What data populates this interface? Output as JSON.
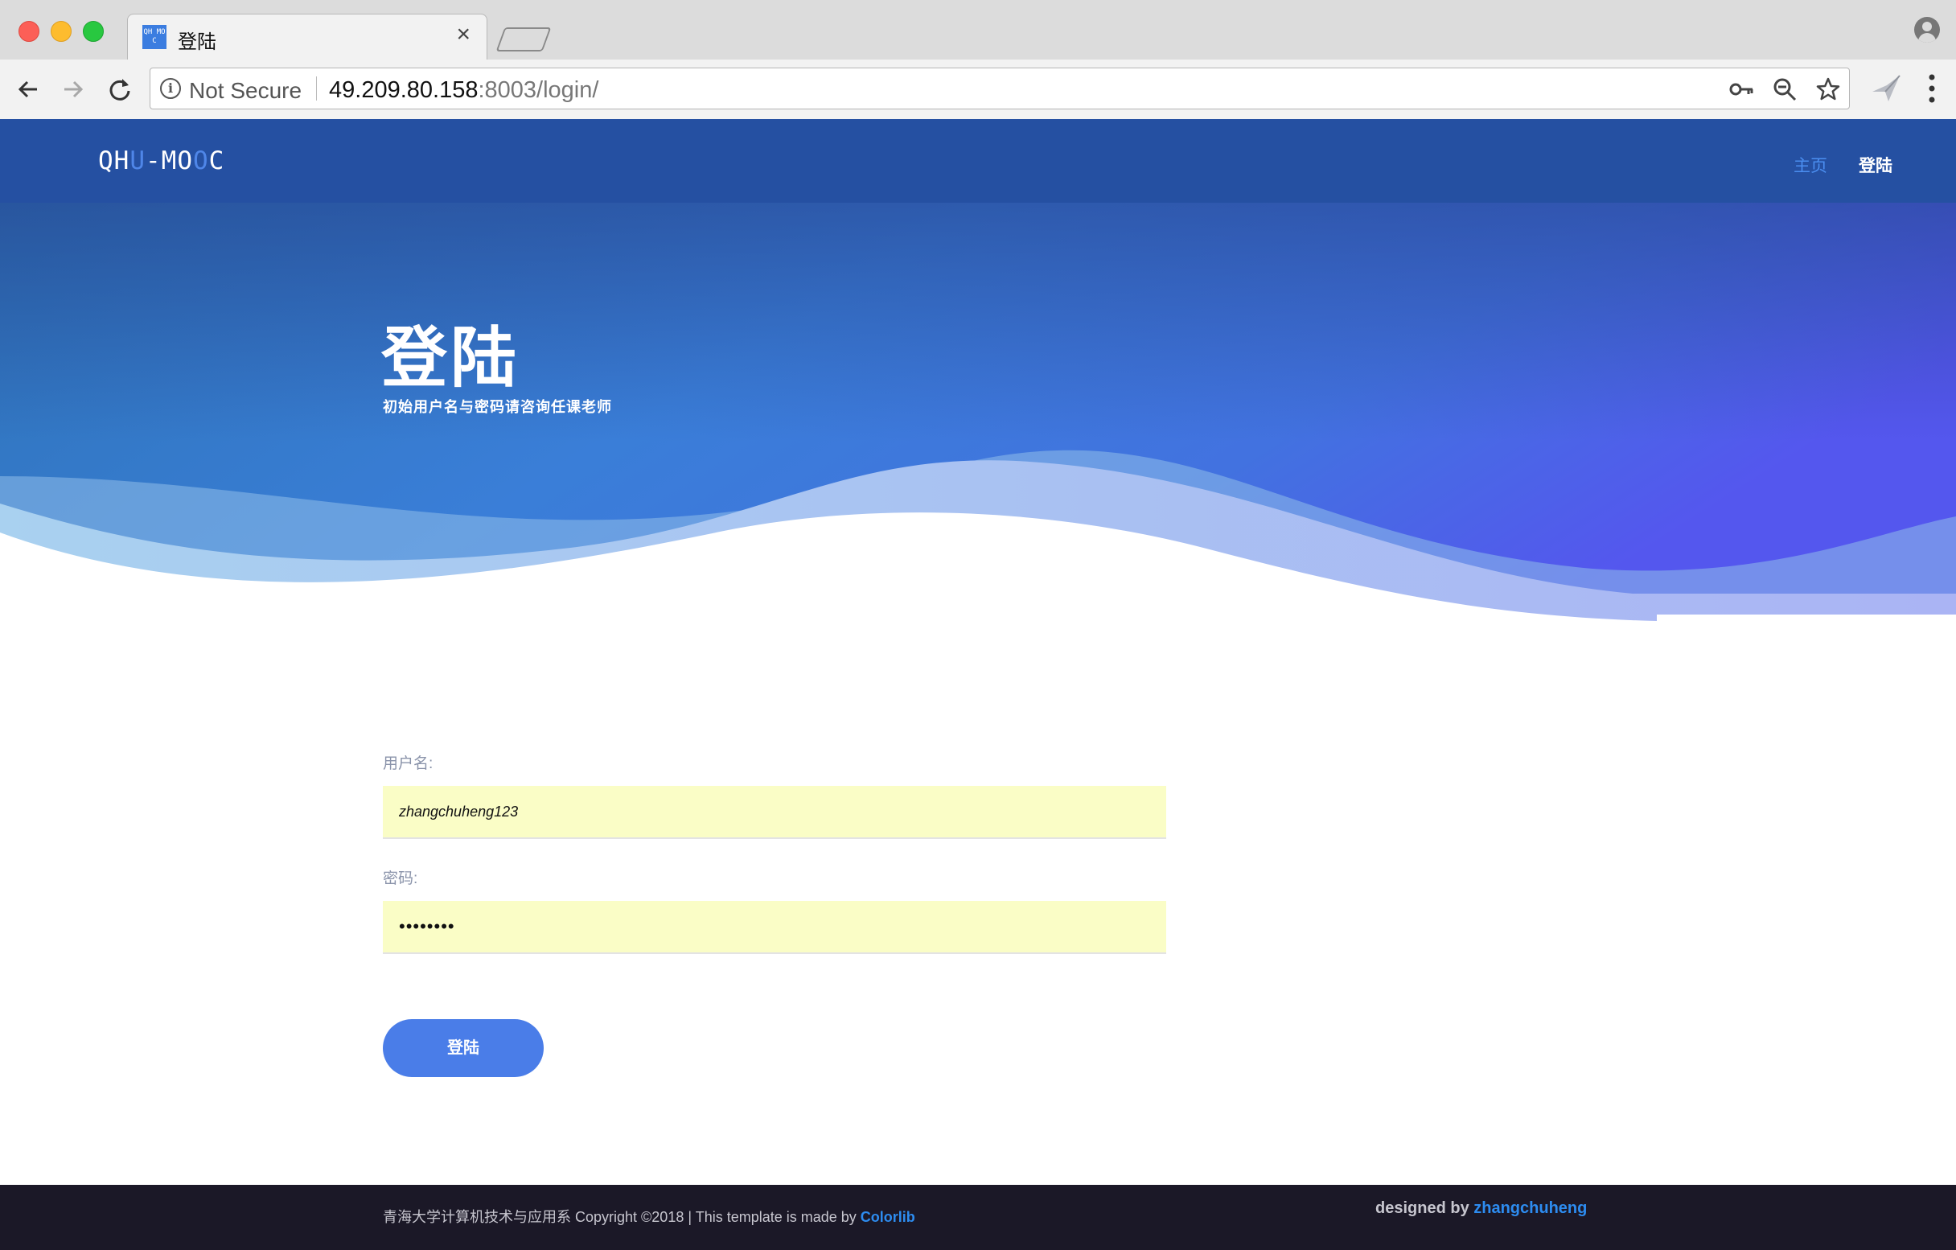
{
  "browser": {
    "tab_title": "登陆",
    "favicon_text": "QH MO C",
    "close_glyph": "×",
    "security_label": "Not Secure",
    "url_host": "49.209.80.158",
    "url_rest": ":8003/login/"
  },
  "site": {
    "logo_parts": [
      "QH",
      "U",
      "-MO",
      "O",
      "C"
    ],
    "nav": {
      "home": "主页",
      "login": "登陆"
    }
  },
  "hero": {
    "title": "登陆",
    "subtitle": "初始用户名与密码请咨询任课老师"
  },
  "form": {
    "username_label": "用户名:",
    "username_value": "zhangchuheng123",
    "password_label": "密码:",
    "password_masked": "••••••••",
    "submit_label": "登陆"
  },
  "footer": {
    "copyright_text": "青海大学计算机技术与应用系 Copyright ©2018 | This template is made by ",
    "copyright_link": "Colorlib",
    "designed_by": "designed by ",
    "designer": "zhangchuheng"
  },
  "colors": {
    "header": "#2550a2",
    "accent": "#4a7de8",
    "input_bg": "#fafdc6",
    "footer": "#1b1827"
  }
}
